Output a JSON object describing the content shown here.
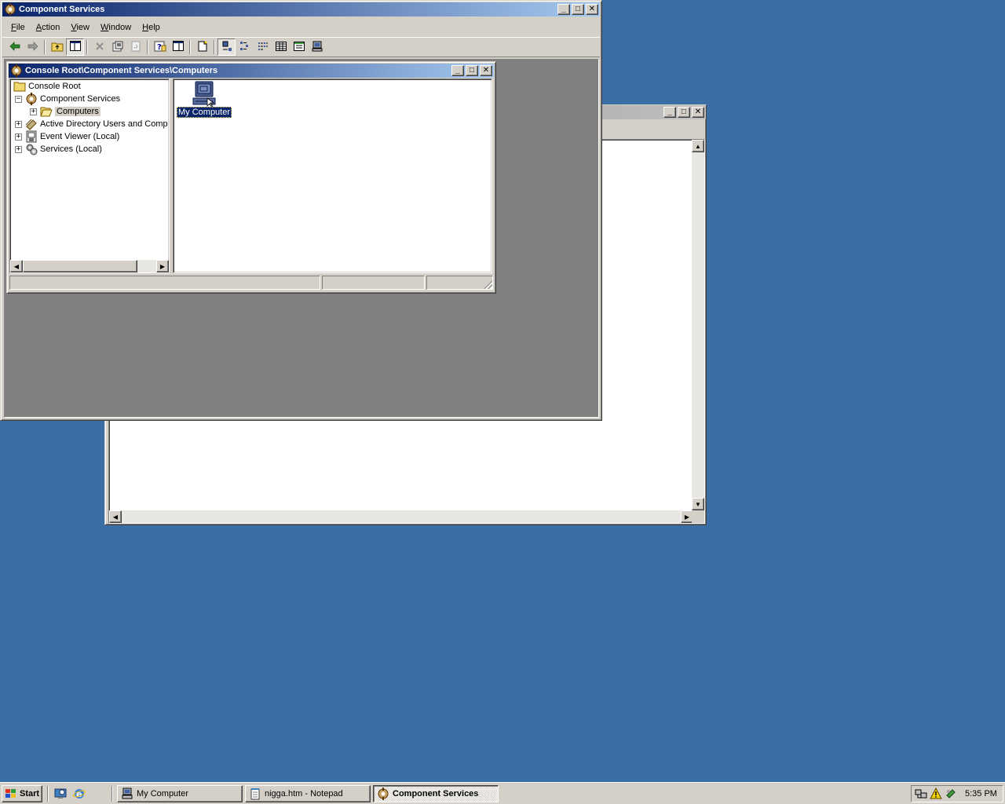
{
  "desktop": {
    "background": "#3a6ea5"
  },
  "main_window": {
    "title": "Component Services",
    "menu": [
      "File",
      "Action",
      "View",
      "Window",
      "Help"
    ],
    "menu_mnemonics": [
      "F",
      "A",
      "V",
      "W",
      "H"
    ],
    "toolbar_icons": [
      "back-arrow-icon",
      "forward-arrow-icon",
      "up-folder-icon",
      "show-hide-tree-icon",
      "delete-icon",
      "properties-icon",
      "refresh-icon",
      "help-icon",
      "show-hide-action-pane-icon",
      "new-window-icon",
      "large-icons-icon",
      "small-icons-icon",
      "list-icon",
      "detail-icon",
      "view-options-icon",
      "computer-icon"
    ]
  },
  "child_window": {
    "title": "Console Root\\Component Services\\Computers",
    "tree": [
      {
        "label": "Console Root",
        "icon": "folder-icon",
        "expander": ""
      },
      {
        "label": "Component Services",
        "icon": "component-services-icon",
        "expander": "−"
      },
      {
        "label": "Computers",
        "icon": "open-folder-icon",
        "expander": "+",
        "selected": true
      },
      {
        "label": "Active Directory Users and Comp",
        "icon": "active-directory-icon",
        "expander": "+"
      },
      {
        "label": "Event Viewer (Local)",
        "icon": "event-viewer-icon",
        "expander": "+"
      },
      {
        "label": "Services (Local)",
        "icon": "services-icon",
        "expander": "+"
      }
    ],
    "content_items": [
      {
        "label": "My Computer",
        "icon": "computer-icon",
        "selected": true
      }
    ]
  },
  "background_window": {
    "title": ""
  },
  "taskbar": {
    "start_label": "Start",
    "quick_launch": [
      "desktop-icon",
      "internet-explorer-icon"
    ],
    "buttons": [
      {
        "label": "My Computer",
        "icon": "computer-icon",
        "active": false
      },
      {
        "label": "nigga.htm - Notepad",
        "icon": "notepad-icon",
        "active": false
      },
      {
        "label": "Component Services",
        "icon": "component-services-icon",
        "active": true
      }
    ],
    "tray_icons": [
      "network-icon",
      "warning-icon",
      "security-icon"
    ],
    "clock": "5:35 PM"
  },
  "colors": {
    "active_title": "#0a246a",
    "selection": "#0a246a",
    "face": "#d4d0c8"
  }
}
